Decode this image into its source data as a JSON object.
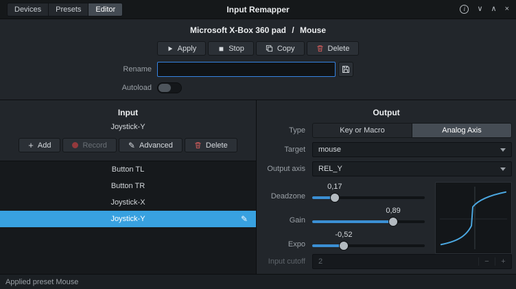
{
  "titlebar": {
    "title": "Input Remapper",
    "tabs": [
      {
        "label": "Devices"
      },
      {
        "label": "Presets"
      },
      {
        "label": "Editor",
        "active": true
      }
    ],
    "controls": [
      {
        "name": "info",
        "glyph": "i"
      },
      {
        "name": "chevron-down",
        "glyph": "∨"
      },
      {
        "name": "chevron-up",
        "glyph": "∧"
      },
      {
        "name": "close",
        "glyph": "×"
      }
    ]
  },
  "header": {
    "device_name": "Microsoft X-Box 360 pad",
    "separator": "/",
    "preset_name": "Mouse",
    "apply_label": "Apply",
    "stop_label": "Stop",
    "copy_label": "Copy",
    "delete_label": "Delete",
    "rename_label": "Rename",
    "rename_value": "",
    "autoload_label": "Autoload"
  },
  "input_panel": {
    "title": "Input",
    "current_input": "Joystick-Y",
    "add_label": "Add",
    "record_label": "Record",
    "advanced_label": "Advanced",
    "delete_label": "Delete",
    "items": [
      {
        "label": "Button TL"
      },
      {
        "label": "Button TR"
      },
      {
        "label": "Joystick-X"
      },
      {
        "label": "Joystick-Y",
        "selected": true
      }
    ]
  },
  "output_panel": {
    "title": "Output",
    "type_label": "Type",
    "type_options": [
      {
        "label": "Key or Macro"
      },
      {
        "label": "Analog Axis",
        "selected": true
      }
    ],
    "target_label": "Target",
    "target_value": "mouse",
    "output_axis_label": "Output axis",
    "output_axis_value": "REL_Y",
    "sliders": [
      {
        "label": "Deadzone",
        "value": "0,17",
        "percent": 20
      },
      {
        "label": "Gain",
        "value": "0,89",
        "percent": 72
      },
      {
        "label": "Expo",
        "value": "-0,52",
        "percent": 28
      }
    ],
    "cutoff_label": "Input cutoff",
    "cutoff_value": "2",
    "decrement_glyph": "−",
    "increment_glyph": "+"
  },
  "statusbar": {
    "text": "Applied preset Mouse"
  },
  "colors": {
    "accent": "#3584e4",
    "selection": "#38a1e0",
    "slider_fill": "#3b8fd4",
    "delete_red": "#cf5b5b",
    "curve_blue": "#4ba7e0"
  }
}
